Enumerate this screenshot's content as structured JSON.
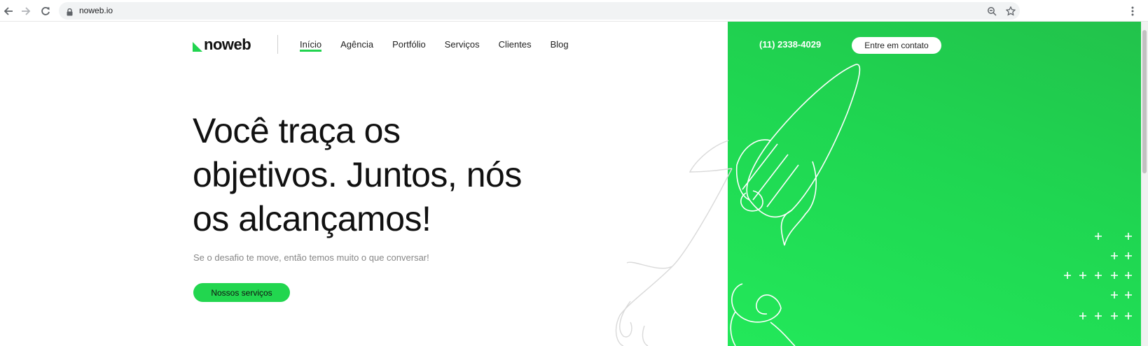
{
  "browser": {
    "url": "noweb.io",
    "icons": [
      "back-arrow-icon",
      "forward-arrow-icon",
      "reload-icon",
      "lock-icon",
      "zoom-icon",
      "star-icon",
      "menu-dots-icon"
    ]
  },
  "header": {
    "logo_text": "noweb",
    "nav": [
      {
        "label": "Início",
        "active": true
      },
      {
        "label": "Agência",
        "active": false
      },
      {
        "label": "Portfólio",
        "active": false
      },
      {
        "label": "Serviços",
        "active": false
      },
      {
        "label": "Clientes",
        "active": false
      },
      {
        "label": "Blog",
        "active": false
      }
    ],
    "phone": "(11) 2338-4029",
    "contact_label": "Entre em contato"
  },
  "hero": {
    "title_lines": [
      "Você traça os",
      "objetivos. Juntos, nós",
      "os alcançamos!"
    ],
    "subtitle": "Se o desafio te move, então temos muito o que conversar!",
    "button_label": "Nossos serviços"
  },
  "colors": {
    "accent": "#22d64f",
    "panel_green": "#1fd651"
  }
}
